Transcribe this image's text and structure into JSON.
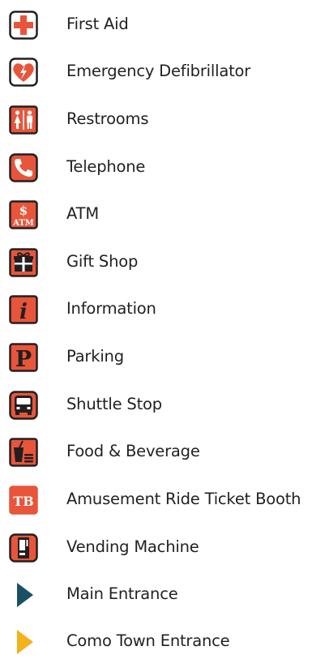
{
  "colors": {
    "accent": "#e8553a",
    "outline": "#231f20",
    "main_entrance": "#1b4f66",
    "como_entrance": "#f4b21b"
  },
  "legend": {
    "items": [
      {
        "icon": "first-aid-icon",
        "label": "First Aid"
      },
      {
        "icon": "defibrillator-icon",
        "label": "Emergency Defibrillator"
      },
      {
        "icon": "restrooms-icon",
        "label": "Restrooms"
      },
      {
        "icon": "telephone-icon",
        "label": "Telephone"
      },
      {
        "icon": "atm-icon",
        "label": "ATM",
        "icon_text_top": "$",
        "icon_text_bottom": "ATM"
      },
      {
        "icon": "gift-icon",
        "label": "Gift Shop"
      },
      {
        "icon": "information-icon",
        "label": "Information",
        "icon_text": "i"
      },
      {
        "icon": "parking-icon",
        "label": "Parking",
        "icon_text": "P"
      },
      {
        "icon": "shuttle-icon",
        "label": "Shuttle Stop"
      },
      {
        "icon": "food-beverage-icon",
        "label": "Food & Beverage"
      },
      {
        "icon": "ticket-booth-icon",
        "label": "Amusement Ride Ticket Booth",
        "icon_text": "TB"
      },
      {
        "icon": "vending-machine-icon",
        "label": "Vending Machine"
      },
      {
        "icon": "main-entrance-icon",
        "label": "Main Entrance"
      },
      {
        "icon": "como-town-entrance-icon",
        "label": "Como Town Entrance"
      }
    ]
  }
}
